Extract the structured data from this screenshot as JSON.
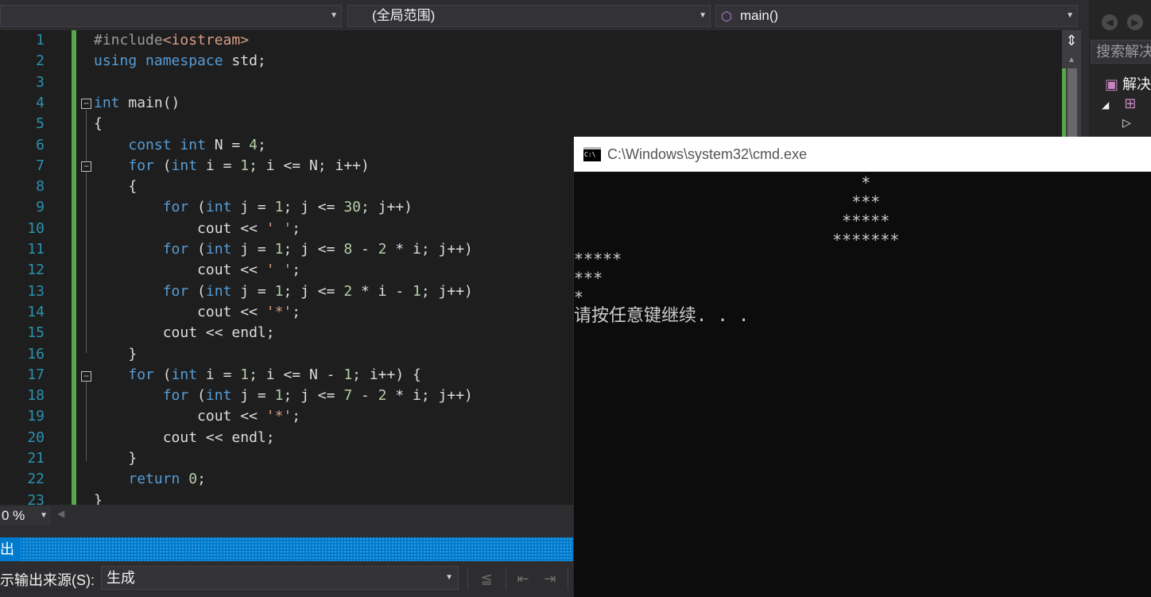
{
  "navbar": {
    "project_combo": "",
    "scope_combo": "(全局范围)",
    "function_combo": "main()"
  },
  "editor": {
    "line_numbers": [
      "1",
      "2",
      "3",
      "4",
      "5",
      "6",
      "7",
      "8",
      "9",
      "10",
      "11",
      "12",
      "13",
      "14",
      "15",
      "16",
      "17",
      "18",
      "19",
      "20",
      "21",
      "22",
      "23"
    ],
    "lines": [
      [
        {
          "t": "#include",
          "c": "inc"
        },
        {
          "t": "<iostream>",
          "c": "str"
        }
      ],
      [
        {
          "t": "using",
          "c": "kw"
        },
        {
          "t": " "
        },
        {
          "t": "namespace",
          "c": "kw"
        },
        {
          "t": " std;"
        }
      ],
      [],
      [
        {
          "t": "int",
          "c": "kw"
        },
        {
          "t": " main()"
        }
      ],
      [
        {
          "t": "{"
        }
      ],
      [
        {
          "t": "    "
        },
        {
          "t": "const",
          "c": "kw"
        },
        {
          "t": " "
        },
        {
          "t": "int",
          "c": "kw"
        },
        {
          "t": " N = "
        },
        {
          "t": "4",
          "c": "num"
        },
        {
          "t": ";"
        }
      ],
      [
        {
          "t": "    "
        },
        {
          "t": "for",
          "c": "kw"
        },
        {
          "t": " ("
        },
        {
          "t": "int",
          "c": "kw"
        },
        {
          "t": " i = "
        },
        {
          "t": "1",
          "c": "num"
        },
        {
          "t": "; i <= N; i++)"
        }
      ],
      [
        {
          "t": "    {"
        }
      ],
      [
        {
          "t": "        "
        },
        {
          "t": "for",
          "c": "kw"
        },
        {
          "t": " ("
        },
        {
          "t": "int",
          "c": "kw"
        },
        {
          "t": " j = "
        },
        {
          "t": "1",
          "c": "num"
        },
        {
          "t": "; j <= "
        },
        {
          "t": "30",
          "c": "num"
        },
        {
          "t": "; j++)"
        }
      ],
      [
        {
          "t": "            cout << "
        },
        {
          "t": "' '",
          "c": "str"
        },
        {
          "t": ";"
        }
      ],
      [
        {
          "t": "        "
        },
        {
          "t": "for",
          "c": "kw"
        },
        {
          "t": " ("
        },
        {
          "t": "int",
          "c": "kw"
        },
        {
          "t": " j = "
        },
        {
          "t": "1",
          "c": "num"
        },
        {
          "t": "; j <= "
        },
        {
          "t": "8",
          "c": "num"
        },
        {
          "t": " - "
        },
        {
          "t": "2",
          "c": "num"
        },
        {
          "t": " * i; j++)"
        }
      ],
      [
        {
          "t": "            cout << "
        },
        {
          "t": "' '",
          "c": "str"
        },
        {
          "t": ";"
        }
      ],
      [
        {
          "t": "        "
        },
        {
          "t": "for",
          "c": "kw"
        },
        {
          "t": " ("
        },
        {
          "t": "int",
          "c": "kw"
        },
        {
          "t": " j = "
        },
        {
          "t": "1",
          "c": "num"
        },
        {
          "t": "; j <= "
        },
        {
          "t": "2",
          "c": "num"
        },
        {
          "t": " * i - "
        },
        {
          "t": "1",
          "c": "num"
        },
        {
          "t": "; j++)"
        }
      ],
      [
        {
          "t": "            cout << "
        },
        {
          "t": "'*'",
          "c": "str"
        },
        {
          "t": ";"
        }
      ],
      [
        {
          "t": "        cout << endl;"
        }
      ],
      [
        {
          "t": "    }"
        }
      ],
      [
        {
          "t": "    "
        },
        {
          "t": "for",
          "c": "kw"
        },
        {
          "t": " ("
        },
        {
          "t": "int",
          "c": "kw"
        },
        {
          "t": " i = "
        },
        {
          "t": "1",
          "c": "num"
        },
        {
          "t": "; i <= N - "
        },
        {
          "t": "1",
          "c": "num"
        },
        {
          "t": "; i++) {"
        }
      ],
      [
        {
          "t": "        "
        },
        {
          "t": "for",
          "c": "kw"
        },
        {
          "t": " ("
        },
        {
          "t": "int",
          "c": "kw"
        },
        {
          "t": " j = "
        },
        {
          "t": "1",
          "c": "num"
        },
        {
          "t": "; j <= "
        },
        {
          "t": "7",
          "c": "num"
        },
        {
          "t": " - "
        },
        {
          "t": "2",
          "c": "num"
        },
        {
          "t": " * i; j++)"
        }
      ],
      [
        {
          "t": "            cout << "
        },
        {
          "t": "'*'",
          "c": "str"
        },
        {
          "t": ";"
        }
      ],
      [
        {
          "t": "        cout << endl;"
        }
      ],
      [
        {
          "t": "    }"
        }
      ],
      [
        {
          "t": "    "
        },
        {
          "t": "return",
          "c": "kw"
        },
        {
          "t": " "
        },
        {
          "t": "0",
          "c": "num"
        },
        {
          "t": ";"
        }
      ],
      [
        {
          "t": "}"
        }
      ]
    ]
  },
  "right_panel": {
    "search_placeholder": "搜索解决方案资源管理器",
    "solution_label": "解决方案"
  },
  "zoom": {
    "value": "0 %"
  },
  "output": {
    "title": "出",
    "source_label": "示输出来源(S):",
    "source_value": "生成"
  },
  "console": {
    "title": "C:\\Windows\\system32\\cmd.exe",
    "lines": [
      "                              *",
      "                             ***",
      "                            *****",
      "                           *******",
      "*****",
      "***",
      "*",
      "请按任意键继续. . ."
    ]
  }
}
